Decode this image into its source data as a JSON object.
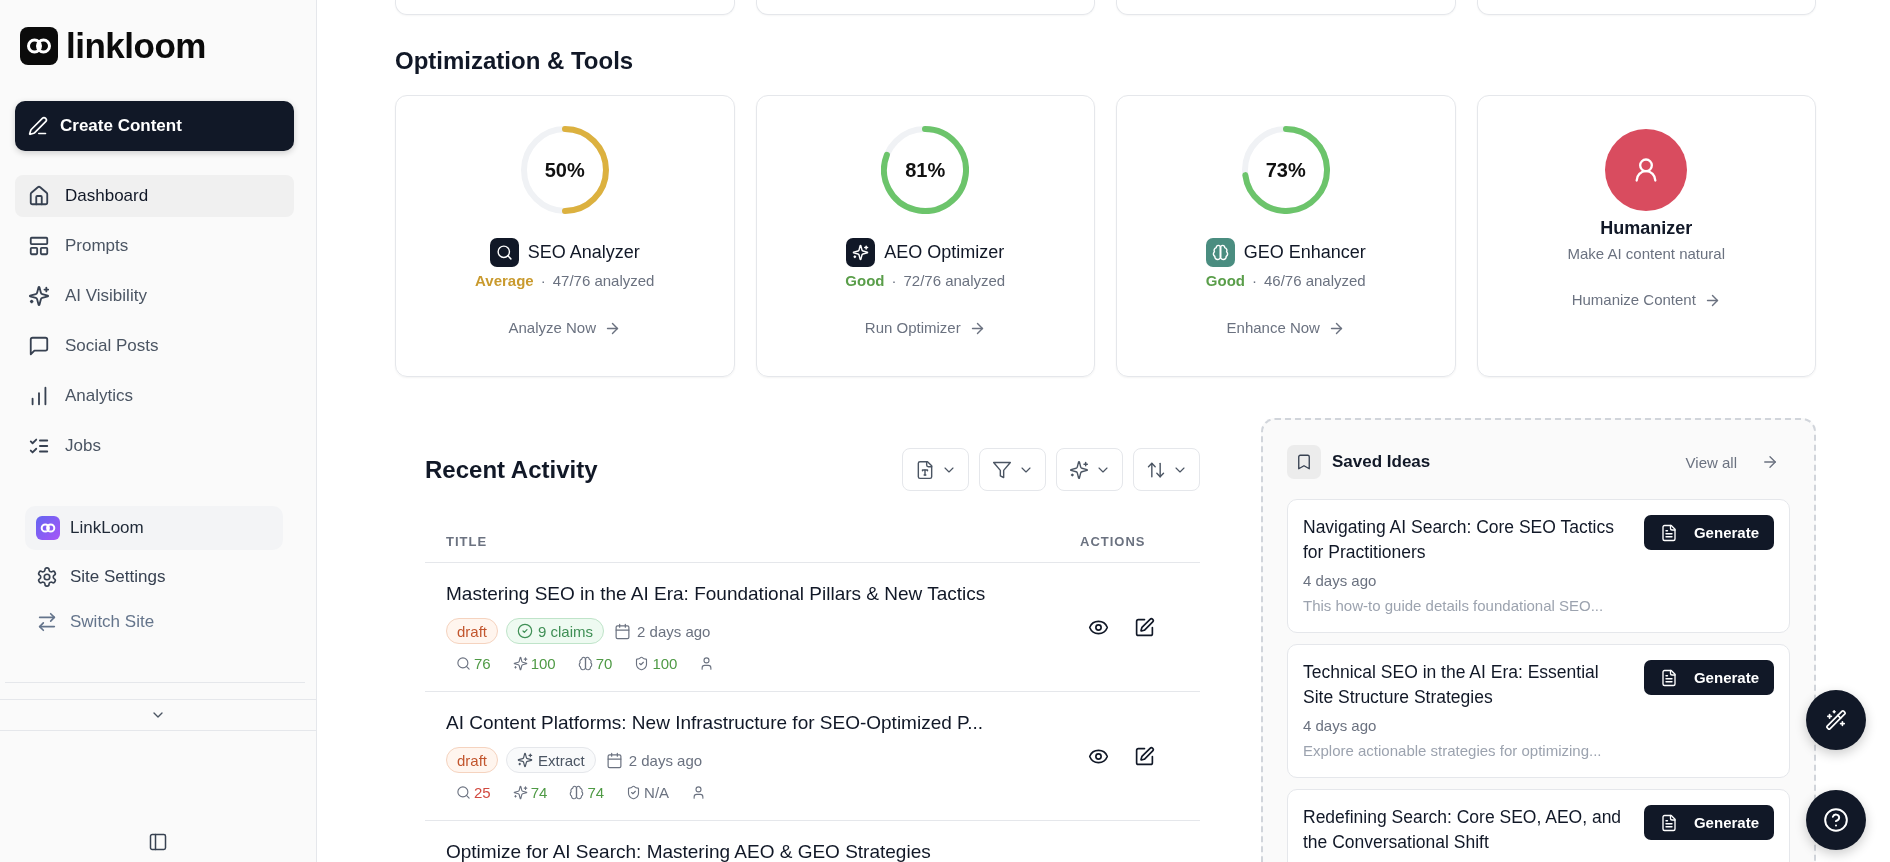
{
  "sidebar": {
    "logo": "linkloom",
    "create_button": "Create Content",
    "nav": [
      {
        "label": "Dashboard",
        "selected": true
      },
      {
        "label": "Prompts",
        "selected": false
      },
      {
        "label": "AI Visibility",
        "selected": false
      },
      {
        "label": "Social Posts",
        "selected": false
      },
      {
        "label": "Analytics",
        "selected": false
      },
      {
        "label": "Jobs",
        "selected": false
      }
    ],
    "site": {
      "name": "LinkLoom",
      "links": [
        {
          "kind": "settings",
          "label": "Site Settings"
        },
        {
          "kind": "switch",
          "label": "Switch Site"
        }
      ]
    }
  },
  "tools": {
    "title": "Optimization & Tools",
    "cards": [
      {
        "kind": "meter",
        "reading": "50%",
        "color": "#dcb13f",
        "icon": {
          "color": "#111827"
        },
        "name": "SEO Analyzer",
        "status": {
          "label": "Average",
          "color": "#c99a2e"
        },
        "separator": "·",
        "count": "47/76 analyzed",
        "action": "Analyze Now"
      },
      {
        "kind": "meter",
        "reading": "81%",
        "color": "#6cc46b",
        "icon": {
          "color": "#111827"
        },
        "name": "AEO Optimizer",
        "status": {
          "label": "Good",
          "color": "#5a9e4a"
        },
        "separator": "·",
        "count": "72/76 analyzed",
        "action": "Run Optimizer"
      },
      {
        "kind": "meter",
        "reading": "73%",
        "color": "#6cc46b",
        "icon": {
          "color": "#4a8d80"
        },
        "name": "GEO Enhancer",
        "status": {
          "label": "Good",
          "color": "#5a9e4a"
        },
        "separator": "·",
        "count": "46/76 analyzed",
        "action": "Enhance Now"
      },
      {
        "kind": "plain",
        "color": "#d94c5f",
        "name": "Humanizer",
        "description": "Make AI content natural",
        "action": "Humanize Content"
      }
    ]
  },
  "recent": {
    "title": "Recent Activity",
    "columns": [
      "TITLE",
      "ACTIONS"
    ],
    "rows": [
      {
        "title": "Mastering SEO in the AI Era: Foundational Pillars & New Tactics",
        "badges": [
          {
            "kind": "status",
            "label": "draft"
          },
          {
            "kind": "verified",
            "label": "9 claims"
          }
        ],
        "date": "2 days ago",
        "scores": [
          {
            "value": "76",
            "color": "#4f9a45"
          },
          {
            "value": "100",
            "color": "#4f9a45"
          },
          {
            "value": "70",
            "color": "#4f9a45"
          },
          {
            "value": "100",
            "color": "#4f9a45"
          }
        ]
      },
      {
        "title": "AI Content Platforms: New Infrastructure for SEO-Optimized P...",
        "badges": [
          {
            "kind": "status",
            "label": "draft"
          },
          {
            "kind": "action",
            "label": "Extract"
          }
        ],
        "date": "2 days ago",
        "scores": [
          {
            "value": "25",
            "color": "#d1493f"
          },
          {
            "value": "74",
            "color": "#4f9a45"
          },
          {
            "value": "74",
            "color": "#4f9a45"
          },
          {
            "value": "N/A",
            "color": "#6b7280"
          }
        ]
      },
      {
        "title": "Optimize for AI Search: Mastering AEO & GEO Strategies"
      }
    ]
  },
  "saved_ideas": {
    "title": "Saved Ideas",
    "view_all": "View all",
    "items": [
      {
        "title": "Navigating AI Search: Core SEO Tactics for Practitioners",
        "date": "4 days ago",
        "description": "This how-to guide details foundational SEO...",
        "button": "Generate"
      },
      {
        "title": "Technical SEO in the AI Era: Essential Site Structure Strategies",
        "date": "4 days ago",
        "description": "Explore actionable strategies for optimizing...",
        "button": "Generate"
      },
      {
        "title": "Redefining Search: Core SEO, AEO, and the Conversational Shift",
        "button": "Generate"
      }
    ]
  }
}
